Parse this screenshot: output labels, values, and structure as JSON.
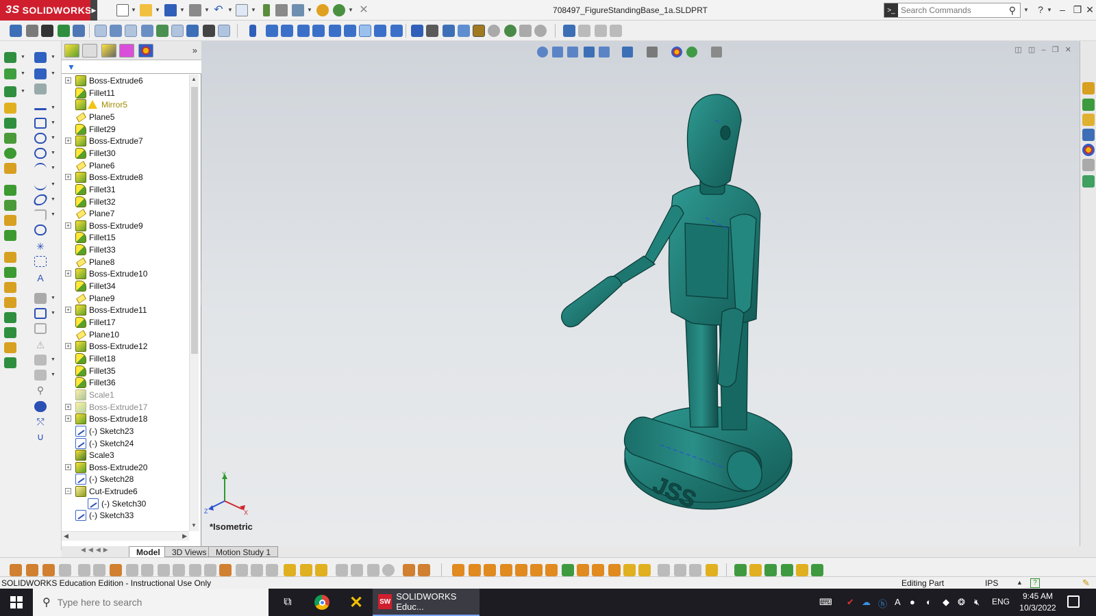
{
  "titlebar": {
    "brand": "SOLIDWORKS",
    "brand_mark": "3S",
    "document_title": "708497_FigureStandingBase_1a.SLDPRT",
    "search_placeholder": "Search Commands",
    "help_glyph": "?",
    "minimize_glyph": "–",
    "restore_glyph": "❐",
    "close_glyph": "✕"
  },
  "feature_tree": {
    "items": [
      {
        "label": "Boss-Extrude6",
        "type": "boss",
        "expandable": true
      },
      {
        "label": "Fillet11",
        "type": "fillet",
        "expandable": false
      },
      {
        "label": "Mirror5",
        "type": "boss",
        "expandable": false,
        "state": "warn"
      },
      {
        "label": "Plane5",
        "type": "plane",
        "expandable": false
      },
      {
        "label": "Fillet29",
        "type": "fillet",
        "expandable": false
      },
      {
        "label": "Boss-Extrude7",
        "type": "boss",
        "expandable": true
      },
      {
        "label": "Fillet30",
        "type": "fillet",
        "expandable": false
      },
      {
        "label": "Plane6",
        "type": "plane",
        "expandable": false
      },
      {
        "label": "Boss-Extrude8",
        "type": "boss",
        "expandable": true
      },
      {
        "label": "Fillet31",
        "type": "fillet",
        "expandable": false
      },
      {
        "label": "Fillet32",
        "type": "fillet",
        "expandable": false
      },
      {
        "label": "Plane7",
        "type": "plane",
        "expandable": false
      },
      {
        "label": "Boss-Extrude9",
        "type": "boss",
        "expandable": true
      },
      {
        "label": "Fillet15",
        "type": "fillet",
        "expandable": false
      },
      {
        "label": "Fillet33",
        "type": "fillet",
        "expandable": false
      },
      {
        "label": "Plane8",
        "type": "plane",
        "expandable": false
      },
      {
        "label": "Boss-Extrude10",
        "type": "boss",
        "expandable": true
      },
      {
        "label": "Fillet34",
        "type": "fillet",
        "expandable": false
      },
      {
        "label": "Plane9",
        "type": "plane",
        "expandable": false
      },
      {
        "label": "Boss-Extrude11",
        "type": "boss",
        "expandable": true
      },
      {
        "label": "Fillet17",
        "type": "fillet",
        "expandable": false
      },
      {
        "label": "Plane10",
        "type": "plane",
        "expandable": false
      },
      {
        "label": "Boss-Extrude12",
        "type": "boss",
        "expandable": true
      },
      {
        "label": "Fillet18",
        "type": "fillet",
        "expandable": false
      },
      {
        "label": "Fillet35",
        "type": "fillet",
        "expandable": false
      },
      {
        "label": "Fillet36",
        "type": "fillet",
        "expandable": false
      },
      {
        "label": "Scale1",
        "type": "scale",
        "expandable": false,
        "state": "suppressed"
      },
      {
        "label": "Boss-Extrude17",
        "type": "boss",
        "expandable": true,
        "state": "suppressed"
      },
      {
        "label": "Boss-Extrude18",
        "type": "boss",
        "expandable": true
      },
      {
        "label": "(-) Sketch23",
        "type": "sketch",
        "expandable": false
      },
      {
        "label": "(-) Sketch24",
        "type": "sketch",
        "expandable": false
      },
      {
        "label": "Scale3",
        "type": "scale",
        "expandable": false
      },
      {
        "label": "Boss-Extrude20",
        "type": "boss",
        "expandable": true
      },
      {
        "label": "(-) Sketch28",
        "type": "sketch",
        "expandable": false
      },
      {
        "label": "Cut-Extrude6",
        "type": "cut",
        "expandable": true,
        "expanded": true
      },
      {
        "label": "(-) Sketch30",
        "type": "sketch",
        "expandable": false,
        "child": true
      },
      {
        "label": "(-) Sketch33",
        "type": "sketch",
        "expandable": false
      }
    ]
  },
  "viewport": {
    "orientation_label": "*Isometric",
    "model_color": "#1f7a74",
    "model_engraving": "JSS",
    "triad": {
      "x": "X",
      "y": "Y",
      "z": "Z"
    }
  },
  "tabs": [
    {
      "label": "Model",
      "active": true
    },
    {
      "label": "3D Views",
      "active": false
    },
    {
      "label": "Motion Study 1",
      "active": false
    }
  ],
  "statusbar": {
    "left_text": "SOLIDWORKS Education Edition - Instructional Use Only",
    "mode": "Editing Part",
    "units": "IPS"
  },
  "taskbar": {
    "search_placeholder": "Type here to search",
    "active_app_label": "SOLIDWORKS Educ...",
    "active_app_icon": "SW",
    "language": "ENG",
    "time": "9:45 AM",
    "date": "10/3/2022"
  },
  "colors": {
    "brand_red": "#cf1f2e",
    "model_teal": "#1f7a74",
    "taskbar_bg": "#1c1c22"
  }
}
